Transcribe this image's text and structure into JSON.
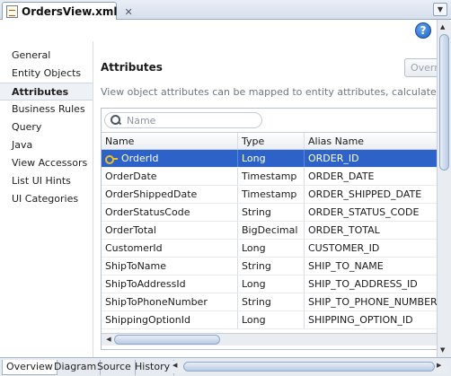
{
  "editor_tab": {
    "label": "OrdersView.xml",
    "close": "✕"
  },
  "help": {
    "glyph": "?"
  },
  "nav": {
    "items": [
      {
        "label": "General"
      },
      {
        "label": "Entity Objects"
      },
      {
        "label": "Attributes",
        "active": true
      },
      {
        "label": "Business Rules"
      },
      {
        "label": "Query"
      },
      {
        "label": "Java"
      },
      {
        "label": "View Accessors"
      },
      {
        "label": "List UI Hints"
      },
      {
        "label": "UI Categories"
      }
    ]
  },
  "main": {
    "title": "Attributes",
    "override_label": "Override",
    "description": "View object attributes can be mapped to entity attributes, calculated or SQL-d",
    "search": {
      "placeholder": "Name"
    },
    "columns": [
      "Name",
      "Type",
      "Alias Name"
    ],
    "rows": [
      {
        "name": "OrderId",
        "type": "Long",
        "alias": "ORDER_ID",
        "key": true,
        "selected": true
      },
      {
        "name": "OrderDate",
        "type": "Timestamp",
        "alias": "ORDER_DATE"
      },
      {
        "name": "OrderShippedDate",
        "type": "Timestamp",
        "alias": "ORDER_SHIPPED_DATE"
      },
      {
        "name": "OrderStatusCode",
        "type": "String",
        "alias": "ORDER_STATUS_CODE"
      },
      {
        "name": "OrderTotal",
        "type": "BigDecimal",
        "alias": "ORDER_TOTAL"
      },
      {
        "name": "CustomerId",
        "type": "Long",
        "alias": "CUSTOMER_ID"
      },
      {
        "name": "ShipToName",
        "type": "String",
        "alias": "SHIP_TO_NAME"
      },
      {
        "name": "ShipToAddressId",
        "type": "Long",
        "alias": "SHIP_TO_ADDRESS_ID"
      },
      {
        "name": "ShipToPhoneNumber",
        "type": "String",
        "alias": "SHIP_TO_PHONE_NUMBER"
      },
      {
        "name": "ShippingOptionId",
        "type": "Long",
        "alias": "SHIPPING_OPTION_ID"
      }
    ]
  },
  "bottom_tabs": [
    {
      "label": "Overview",
      "active": true
    },
    {
      "label": "Diagram"
    },
    {
      "label": "Source"
    },
    {
      "label": "History"
    }
  ],
  "colors": {
    "selection": "#2d63c8",
    "key_icon": "#f0c020"
  }
}
